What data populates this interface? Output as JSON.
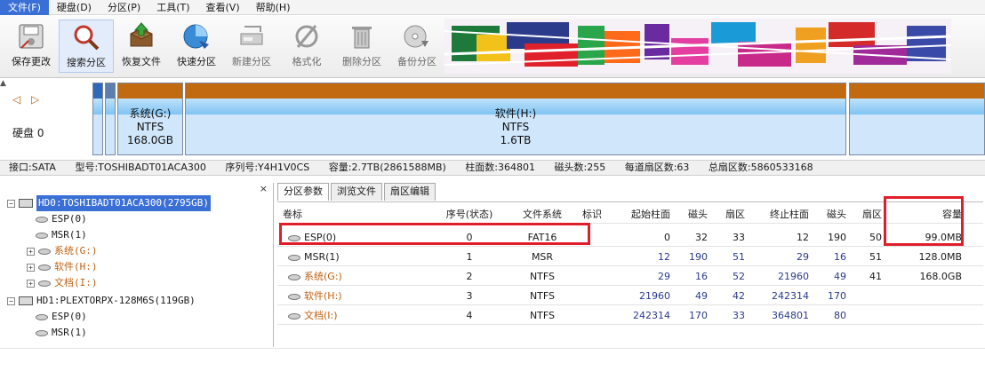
{
  "menu": [
    {
      "label": "文件(F)",
      "active": true
    },
    {
      "label": "硬盘(D)",
      "active": false
    },
    {
      "label": "分区(P)",
      "active": false
    },
    {
      "label": "工具(T)",
      "active": false
    },
    {
      "label": "查看(V)",
      "active": false
    },
    {
      "label": "帮助(H)",
      "active": false
    }
  ],
  "toolbar": {
    "save": "保存更改",
    "search": "搜索分区",
    "recover": "恢复文件",
    "quick": "快速分区",
    "new": "新建分区",
    "format": "格式化",
    "delete": "删除分区",
    "backup": "备份分区"
  },
  "diskmap": {
    "nav": "◁ ▷",
    "disk_label": "硬盘 0",
    "collapse": "▲",
    "seg_system": {
      "name": "系统(G:)",
      "fs": "NTFS",
      "size": "168.0GB"
    },
    "seg_software": {
      "name": "软件(H:)",
      "fs": "NTFS",
      "size": "1.6TB"
    }
  },
  "infobar": {
    "port": "接口:SATA",
    "model": "型号:TOSHIBADT01ACA300",
    "serial": "序列号:Y4H1V0CS",
    "capacity": "容量:2.7TB(2861588MB)",
    "cylinders": "柱面数:364801",
    "heads": "磁头数:255",
    "sectors_per_track": "每道扇区数:63",
    "total_sectors": "总扇区数:5860533168"
  },
  "tree": {
    "close": "×",
    "items": [
      {
        "type": "disk",
        "text": "HD0:TOSHIBADT01ACA300(2795GB)",
        "selected": true
      },
      {
        "type": "part",
        "text": "ESP(0)",
        "orange": false
      },
      {
        "type": "part",
        "text": "MSR(1)",
        "orange": false
      },
      {
        "type": "part",
        "text": "系统(G:)",
        "orange": true
      },
      {
        "type": "part",
        "text": "软件(H:)",
        "orange": true
      },
      {
        "type": "part",
        "text": "文档(I:)",
        "orange": true
      },
      {
        "type": "disk",
        "text": "HD1:PLEXTORPX-128M6S(119GB)",
        "selected": false
      },
      {
        "type": "part",
        "text": "ESP(0)",
        "orange": false
      },
      {
        "type": "part",
        "text": "MSR(1)",
        "orange": false
      }
    ]
  },
  "tabs": [
    "分区参数",
    "浏览文件",
    "扇区编辑"
  ],
  "table": {
    "headers": [
      "卷标",
      "序号(状态)",
      "文件系统",
      "标识",
      "起始柱面",
      "磁头",
      "扇区",
      "终止柱面",
      "磁头",
      "扇区",
      "容量"
    ],
    "rows": [
      [
        "ESP(0)",
        "0",
        "FAT16",
        "",
        "0",
        "32",
        "33",
        "12",
        "190",
        "50",
        "99.0MB"
      ],
      [
        "MSR(1)",
        "1",
        "MSR",
        "",
        "12",
        "190",
        "51",
        "29",
        "16",
        "51",
        "128.0MB"
      ],
      [
        "系统(G:)",
        "2",
        "NTFS",
        "",
        "29",
        "16",
        "52",
        "21960",
        "49",
        "41",
        "168.0GB"
      ],
      [
        "软件(H:)",
        "3",
        "NTFS",
        "",
        "21960",
        "49",
        "42",
        "242314",
        "170",
        "",
        ""
      ],
      [
        "文档(I:)",
        "4",
        "NTFS",
        "",
        "242314",
        "170",
        "33",
        "364801",
        "80",
        "",
        ""
      ]
    ]
  },
  "colors": {
    "accent": "#3a6fd6",
    "primary_partition_bar": "#c26a10",
    "highlight_box": "#e01e2b"
  }
}
